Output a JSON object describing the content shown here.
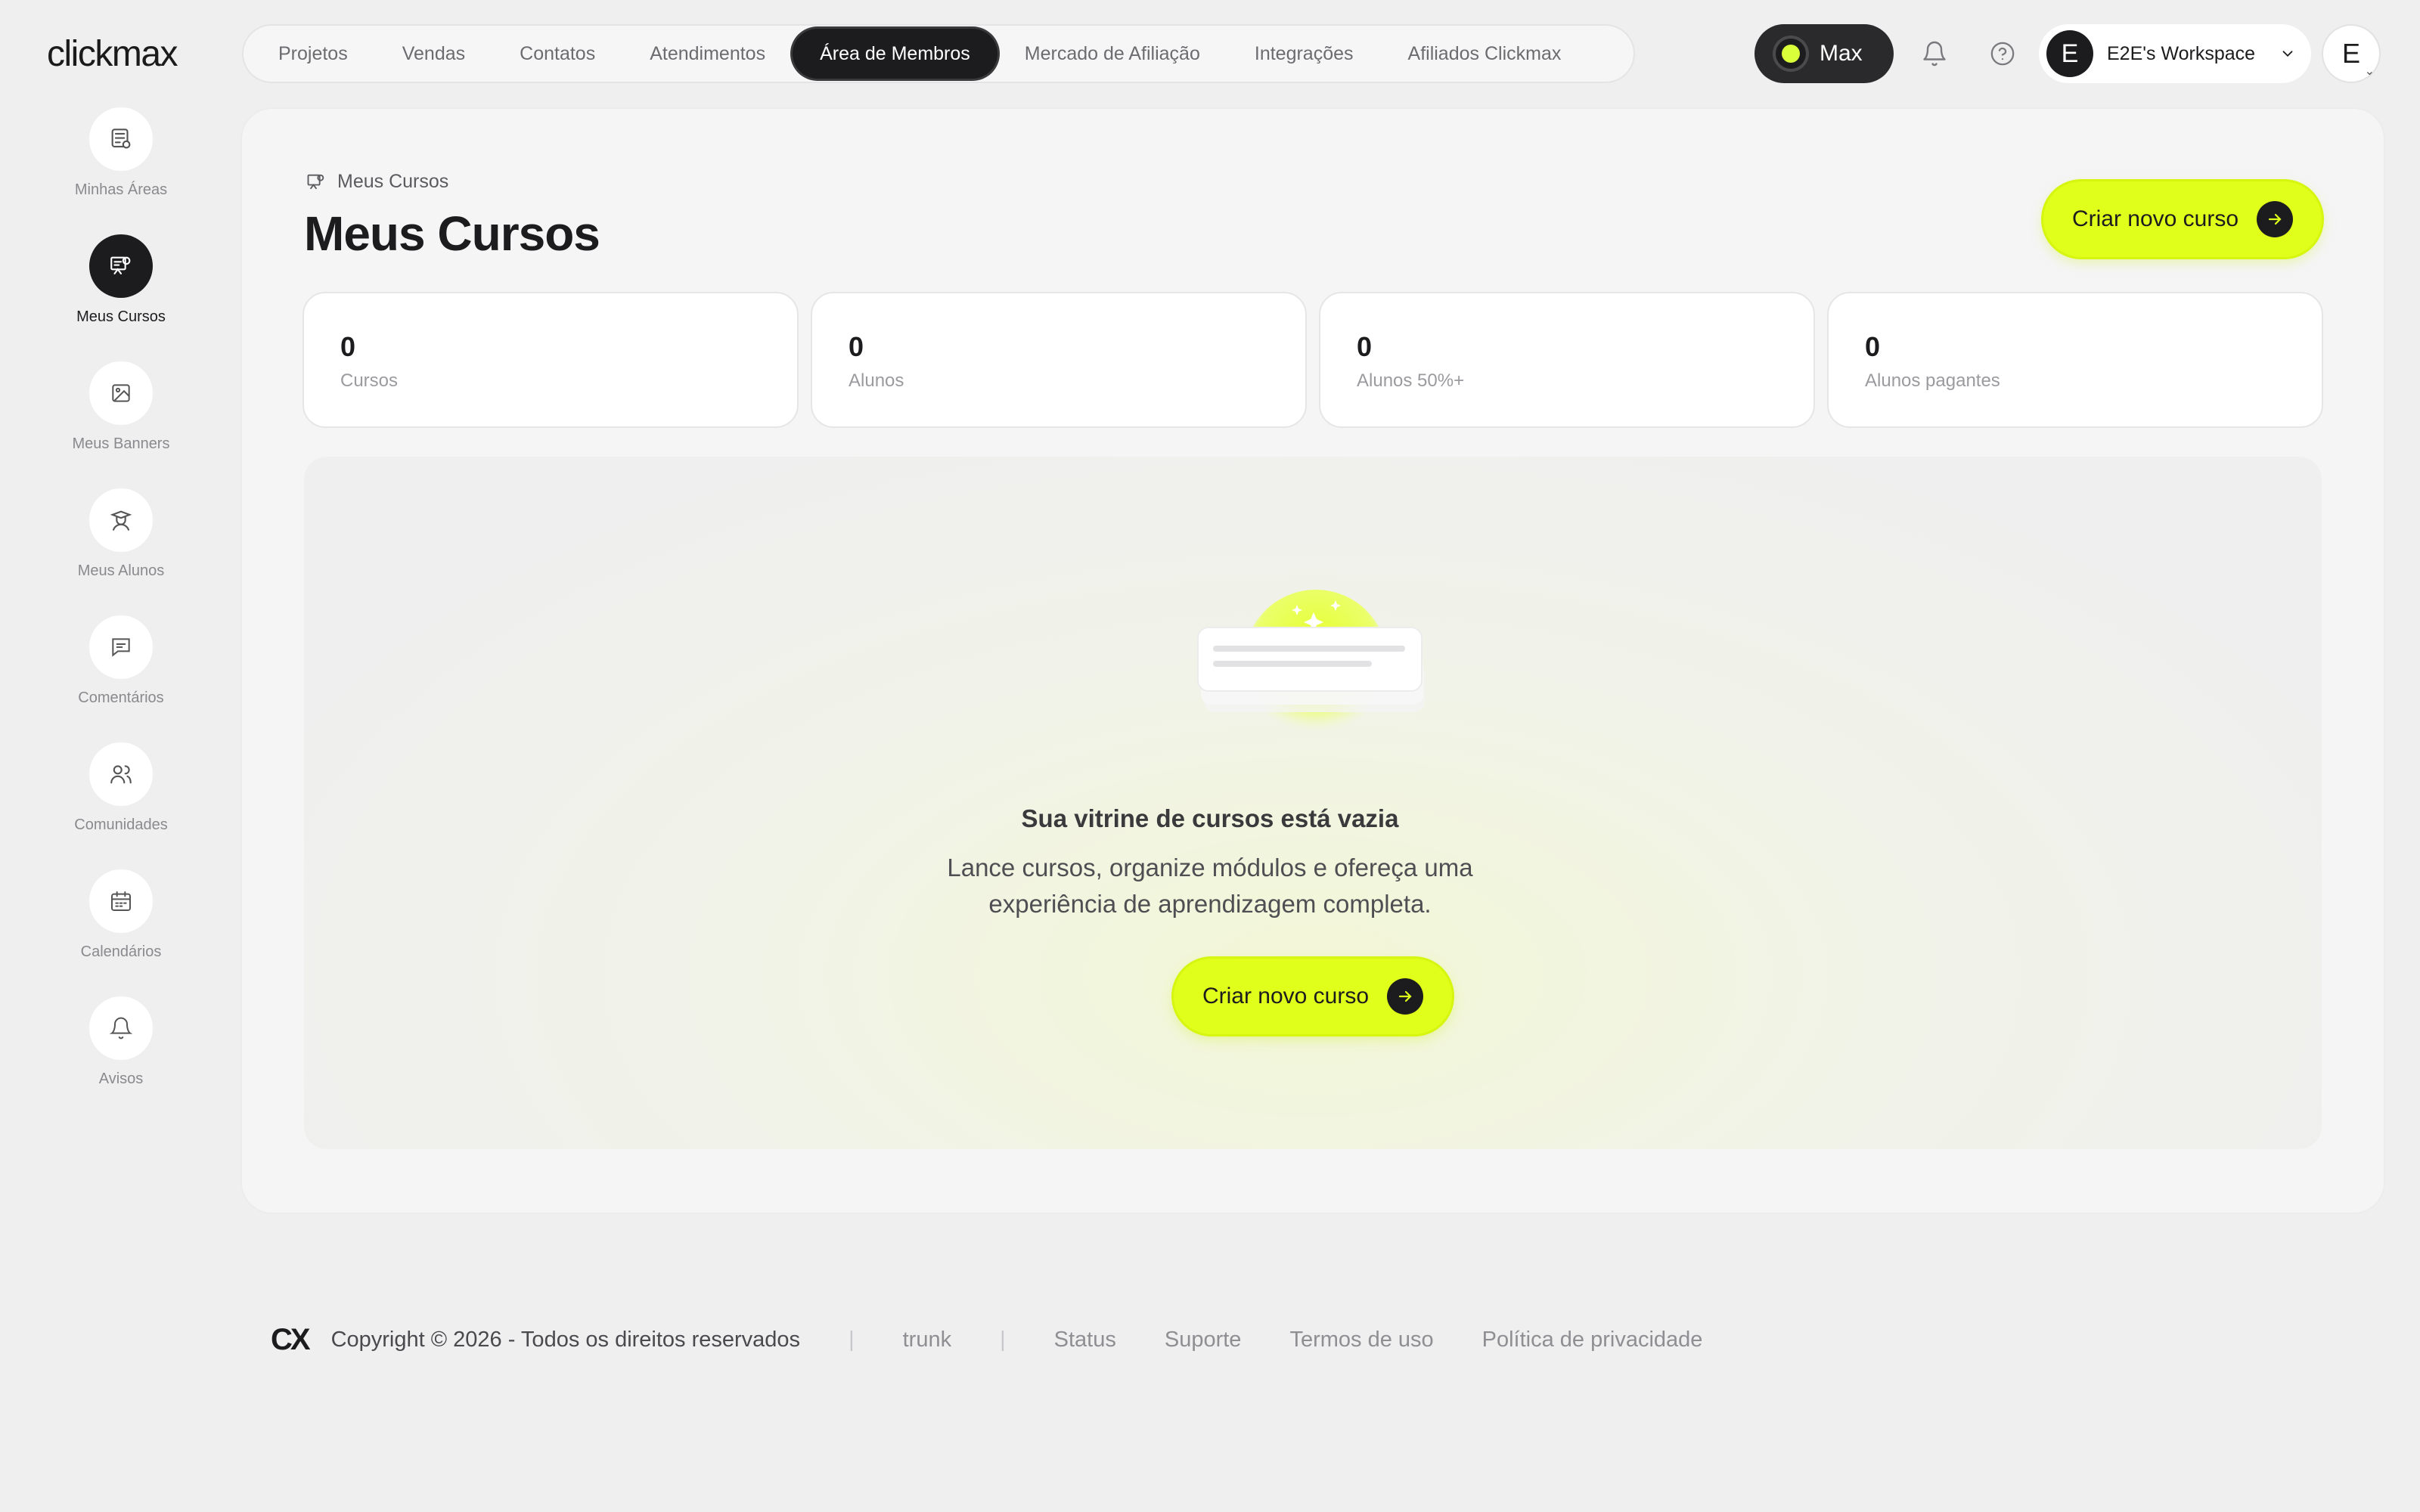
{
  "brand": {
    "logo": "clickmax",
    "footer_logo": "CX"
  },
  "top_nav": {
    "tabs": [
      "Projetos",
      "Vendas",
      "Contatos",
      "Atendimentos",
      "Área de Membros",
      "Mercado de Afiliação",
      "Integrações",
      "Afiliados Clickmax"
    ],
    "active": "Área de Membros"
  },
  "header": {
    "plan_label": "Max",
    "workspace_initial": "E",
    "workspace_name": "E2E's Workspace",
    "user_initial": "E",
    "icons": [
      "bell-icon",
      "help-circle-icon",
      "chevron-down-icon"
    ]
  },
  "sidebar": {
    "items": [
      {
        "label": "Minhas Áreas",
        "icon": "areas-icon",
        "active": false
      },
      {
        "label": "Meus Cursos",
        "icon": "courses-icon",
        "active": true
      },
      {
        "label": "Meus Banners",
        "icon": "image-icon",
        "active": false
      },
      {
        "label": "Meus Alunos",
        "icon": "student-icon",
        "active": false
      },
      {
        "label": "Comentários",
        "icon": "comment-icon",
        "active": false
      },
      {
        "label": "Comunidades",
        "icon": "users-icon",
        "active": false
      },
      {
        "label": "Calendários",
        "icon": "calendar-icon",
        "active": false
      },
      {
        "label": "Avisos",
        "icon": "bell-icon",
        "active": false
      }
    ]
  },
  "main": {
    "breadcrumb": "Meus Cursos",
    "title": "Meus Cursos",
    "create_button": "Criar novo curso",
    "stats": [
      {
        "value": "0",
        "label": "Cursos"
      },
      {
        "value": "0",
        "label": "Alunos"
      },
      {
        "value": "0",
        "label": "Alunos 50%+"
      },
      {
        "value": "0",
        "label": "Alunos pagantes"
      }
    ],
    "empty_state": {
      "title": "Sua vitrine de cursos está vazia",
      "description": "Lance cursos, organize módulos e ofereça uma experiência de aprendizagem completa.",
      "button": "Criar novo curso"
    }
  },
  "footer": {
    "copyright": "Copyright © 2026 - Todos os direitos reservados",
    "branch": "trunk",
    "links": [
      "Status",
      "Suporte",
      "Termos de uso",
      "Política de privacidade"
    ]
  },
  "colors": {
    "accent": "#e0ff1a",
    "dark": "#1c1c1e",
    "background": "#efeff0"
  }
}
